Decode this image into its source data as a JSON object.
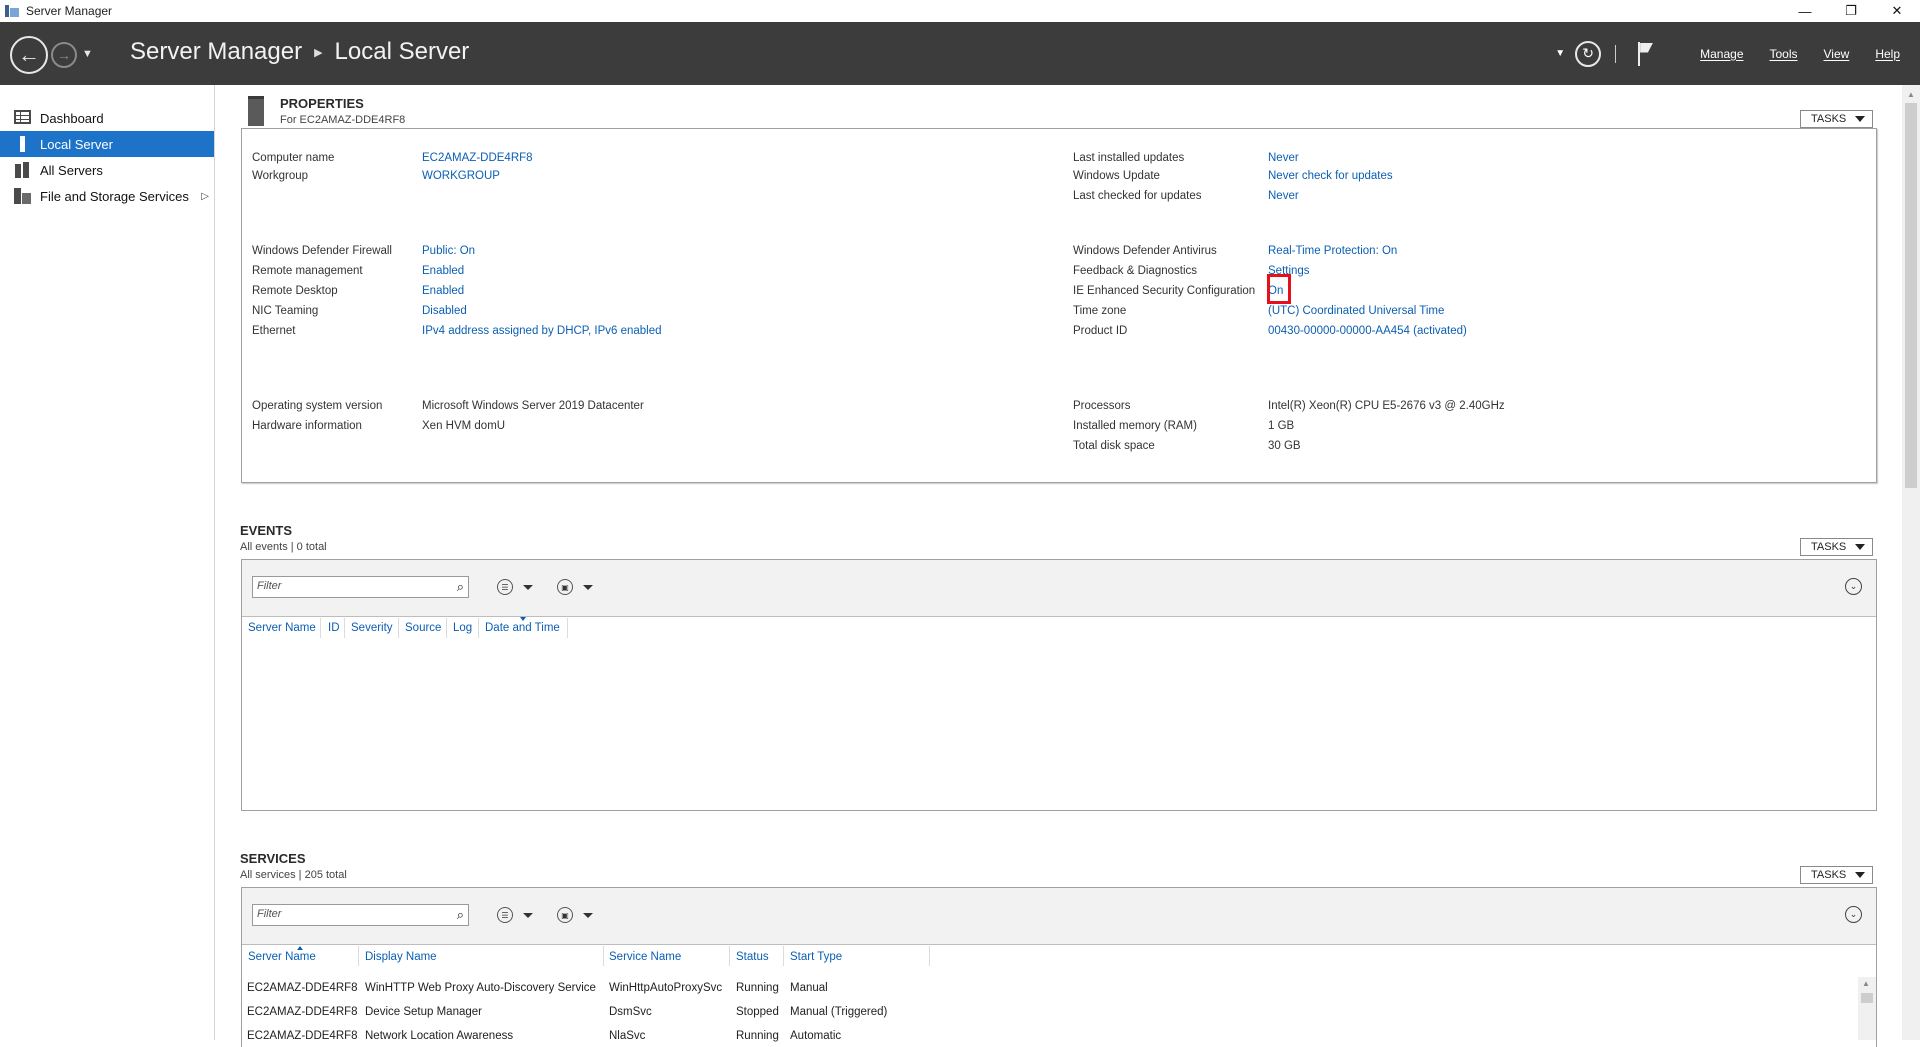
{
  "window": {
    "title": "Server Manager",
    "controls": {
      "minimize": "—",
      "restore": "❐",
      "close": "✕"
    }
  },
  "header": {
    "app": "Server Manager",
    "page": "Local Server",
    "menu": [
      "Manage",
      "Tools",
      "View",
      "Help"
    ]
  },
  "sidebar": {
    "items": [
      {
        "label": "Dashboard",
        "icon": "dashboard-icon",
        "active": false
      },
      {
        "label": "Local Server",
        "icon": "server-icon",
        "active": true
      },
      {
        "label": "All Servers",
        "icon": "servers-icon",
        "active": false
      },
      {
        "label": "File and Storage Services",
        "icon": "storage-icon",
        "active": false,
        "has_children": true
      }
    ]
  },
  "properties": {
    "title": "PROPERTIES",
    "subtitle": "For EC2AMAZ-DDE4RF8",
    "tasks_label": "TASKS",
    "left_groups": [
      [
        {
          "label": "Computer name",
          "value": "EC2AMAZ-DDE4RF8",
          "link": true
        },
        {
          "label": "Workgroup",
          "value": "WORKGROUP",
          "link": true
        }
      ],
      [
        {
          "label": "Windows Defender Firewall",
          "value": "Public: On",
          "link": true
        },
        {
          "label": "Remote management",
          "value": "Enabled",
          "link": true
        },
        {
          "label": "Remote Desktop",
          "value": "Enabled",
          "link": true
        },
        {
          "label": "NIC Teaming",
          "value": "Disabled",
          "link": true
        },
        {
          "label": "Ethernet",
          "value": "IPv4 address assigned by DHCP, IPv6 enabled",
          "link": true
        }
      ],
      [
        {
          "label": "Operating system version",
          "value": "Microsoft Windows Server 2019 Datacenter",
          "link": false
        },
        {
          "label": "Hardware information",
          "value": "Xen HVM domU",
          "link": false
        }
      ]
    ],
    "right_groups": [
      [
        {
          "label": "Last installed updates",
          "value": "Never",
          "link": true
        },
        {
          "label": "Windows Update",
          "value": "Never check for updates",
          "link": true
        },
        {
          "label": "Last checked for updates",
          "value": "Never",
          "link": true
        }
      ],
      [
        {
          "label": "Windows Defender Antivirus",
          "value": "Real-Time Protection: On",
          "link": true
        },
        {
          "label": "Feedback & Diagnostics",
          "value": "Settings",
          "link": true
        },
        {
          "label": "IE Enhanced Security Configuration",
          "value": "On",
          "link": true
        },
        {
          "label": "Time zone",
          "value": "(UTC) Coordinated Universal Time",
          "link": true
        },
        {
          "label": "Product ID",
          "value": "00430-00000-00000-AA454 (activated)",
          "link": true
        }
      ],
      [
        {
          "label": "Processors",
          "value": "Intel(R) Xeon(R) CPU E5-2676 v3 @ 2.40GHz",
          "link": false
        },
        {
          "label": "Installed memory (RAM)",
          "value": "1 GB",
          "link": false
        },
        {
          "label": "Total disk space",
          "value": "30 GB",
          "link": false
        }
      ]
    ]
  },
  "events": {
    "title": "EVENTS",
    "subtitle": "All events | 0 total",
    "tasks_label": "TASKS",
    "filter_placeholder": "Filter",
    "columns": [
      "Server Name",
      "ID",
      "Severity",
      "Source",
      "Log",
      "Date and Time"
    ]
  },
  "services": {
    "title": "SERVICES",
    "subtitle": "All services | 205 total",
    "tasks_label": "TASKS",
    "filter_placeholder": "Filter",
    "columns": [
      "Server Name",
      "Display Name",
      "Service Name",
      "Status",
      "Start Type"
    ],
    "rows": [
      [
        "EC2AMAZ-DDE4RF8",
        "WinHTTP Web Proxy Auto-Discovery Service",
        "WinHttpAutoProxySvc",
        "Running",
        "Manual"
      ],
      [
        "EC2AMAZ-DDE4RF8",
        "Device Setup Manager",
        "DsmSvc",
        "Stopped",
        "Manual (Triggered)"
      ],
      [
        "EC2AMAZ-DDE4RF8",
        "Network Location Awareness",
        "NlaSvc",
        "Running",
        "Automatic"
      ]
    ]
  },
  "colors": {
    "header_bg": "#3c3c3c",
    "accent": "#1c73c7",
    "link": "#0b5fb3",
    "highlight": "#e5101a"
  }
}
